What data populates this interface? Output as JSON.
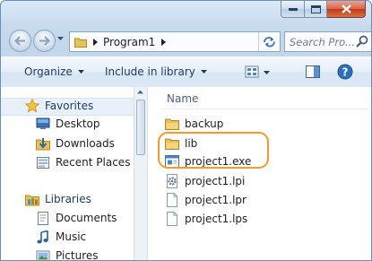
{
  "window": {
    "address": {
      "crumb": "Program1"
    },
    "search": {
      "placeholder": "Search Pro..."
    }
  },
  "toolbar": {
    "organize_label": "Organize",
    "include_label": "Include in library"
  },
  "nav": {
    "favorites_label": "Favorites",
    "items_favorites": [
      "Desktop",
      "Downloads",
      "Recent Places"
    ],
    "libraries_label": "Libraries",
    "items_libraries": [
      "Documents",
      "Music",
      "Pictures"
    ]
  },
  "content": {
    "column_name": "Name",
    "files": [
      {
        "name": "backup",
        "type": "folder"
      },
      {
        "name": "lib",
        "type": "folder"
      },
      {
        "name": "project1.exe",
        "type": "exe"
      },
      {
        "name": "project1.lpi",
        "type": "config"
      },
      {
        "name": "project1.lpr",
        "type": "file"
      },
      {
        "name": "project1.lps",
        "type": "file"
      }
    ]
  },
  "colors": {
    "highlight": "#f29a2e",
    "folder": "#e8c15a",
    "accent": "#1e3a5f"
  }
}
